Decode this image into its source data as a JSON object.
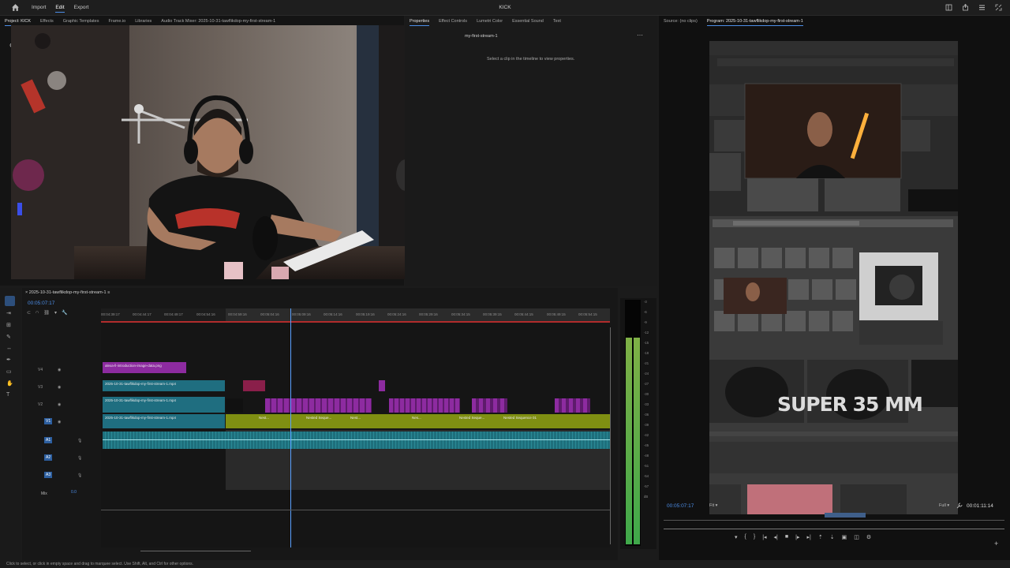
{
  "app": {
    "title": "KICK",
    "menu": [
      "Import",
      "Edit",
      "Export"
    ],
    "active_menu": "Edit"
  },
  "source_panel": {
    "tabs": [
      "Project: KICK",
      "Effects",
      "Graphic Templates",
      "Frame.io",
      "Libraries",
      "Audio Track Mixer: 2025-10-31-tawflikdop-my-first-stream-1"
    ]
  },
  "properties_panel": {
    "tabs": [
      "Properties",
      "Effect Controls",
      "Lumetri Color",
      "Essential Sound",
      "Text"
    ],
    "clip_name": "my-first-stream-1",
    "hint": "Select a clip in the timeline to view properties."
  },
  "program_panel": {
    "source_tab": "Source: (no clips)",
    "program_tab": "Program: 2025-10-31-tawflikdop-my-first-stream-1",
    "overlay_text": "SUPER 35 MM",
    "timecode": "00:05:07:17",
    "fit": "Fit",
    "quality": "Full",
    "duration": "00:01:11:14"
  },
  "timeline": {
    "sequence_name": "2025-10-31-tawflikdop-my-first-stream-1",
    "timecode": "00:05:07:17",
    "ruler": [
      "00:04:39:17",
      "00:04:44:17",
      "00:04:49:17",
      "00:04:54:16",
      "00:04:59:16",
      "00:05:04:16",
      "00:05:09:16",
      "00:05:14:16",
      "00:05:19:16",
      "00:05:24:16",
      "00:05:29:16",
      "00:05:34:15",
      "00:05:39:15",
      "00:05:44:15",
      "00:05:49:15",
      "00:05:54:15"
    ],
    "tracks": [
      "V4",
      "V3",
      "V2",
      "V1",
      "A1",
      "A2",
      "A3"
    ],
    "mix_label": "Mix",
    "mix_value": "0.0",
    "clips": {
      "v4": "alexa-ll-introduction-image-data.png",
      "v3": "2025-10-31-tawflikdop-my-first-stream-1.mp4",
      "v2": "2025-10-31-tawflikdop-my-first-stream-1.mp4",
      "v1": "2025-10-31-tawflikdop-my-first-stream-1.mp4",
      "nested_1": "Nest...",
      "nested_2": "Nested Seque...",
      "nested_3": "Nest...",
      "nested_4": "Nes...",
      "nested_5": "Nested Seque...",
      "nested_6": "Nested Sequence 01"
    }
  },
  "meters": {
    "scale": [
      "-3",
      "-6",
      "-9",
      "-12",
      "-15",
      "-18",
      "-21",
      "-24",
      "-27",
      "-30",
      "-33",
      "-36",
      "-39",
      "-42",
      "-45",
      "-48",
      "-51",
      "-54",
      "-57",
      "dB"
    ]
  },
  "status_bar": {
    "text": "Click to select, or click in empty space and drag to marquee select. Use Shift, Alt, and Ctrl for other options."
  },
  "colors": {
    "accent": "#4c8ee8",
    "playhead": "#5aa0ff",
    "clip_teal": "#1f6e80",
    "clip_purple": "#8d2ba0",
    "clip_olive": "#7f8f12",
    "audio_teal": "#1e6f7c",
    "meter_green": "#3fa84a"
  }
}
